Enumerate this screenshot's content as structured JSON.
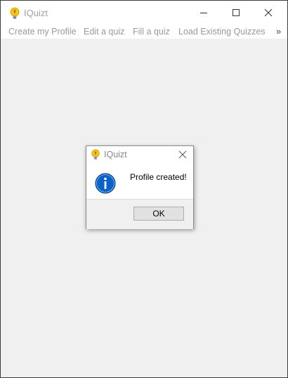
{
  "window": {
    "title": "IQuizt"
  },
  "menubar": {
    "items": [
      {
        "label": "Create my Profile"
      },
      {
        "label": "Edit a quiz"
      },
      {
        "label": "Fill a quiz"
      },
      {
        "label": "Load Existing Quizzes"
      }
    ],
    "overflow_glyph": "»"
  },
  "dialog": {
    "title": "IQuizt",
    "message": "Profile created!",
    "ok_label": "OK"
  },
  "icons": {
    "app": "lightbulb-icon",
    "info": "info-icon"
  },
  "colors": {
    "info_blue": "#0a64c8",
    "bulb_yellow": "#f5c518",
    "client_background": "#f0f0f0"
  }
}
